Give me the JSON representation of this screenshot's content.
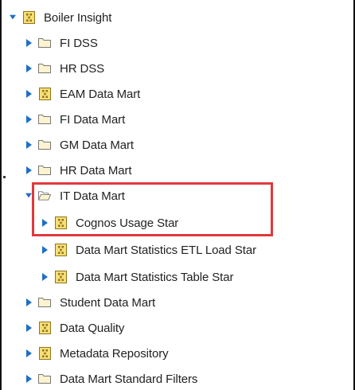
{
  "tree": {
    "items": [
      {
        "label": "Boiler Insight",
        "type": "package",
        "expanded": true,
        "level": 0
      },
      {
        "label": "FI DSS",
        "type": "folder",
        "expanded": false,
        "level": 1
      },
      {
        "label": "HR DSS",
        "type": "folder",
        "expanded": false,
        "level": 1
      },
      {
        "label": "EAM Data Mart",
        "type": "package",
        "expanded": false,
        "level": 1
      },
      {
        "label": "FI Data Mart",
        "type": "folder",
        "expanded": false,
        "level": 1
      },
      {
        "label": "GM Data Mart",
        "type": "folder",
        "expanded": false,
        "level": 1
      },
      {
        "label": "HR Data Mart",
        "type": "folder",
        "expanded": false,
        "level": 1
      },
      {
        "label": "IT Data Mart",
        "type": "folder-open",
        "expanded": true,
        "level": 1
      },
      {
        "label": "Cognos Usage Star",
        "type": "package",
        "expanded": false,
        "level": 2
      },
      {
        "label": "Data Mart Statistics ETL Load Star",
        "type": "package",
        "expanded": false,
        "level": 2
      },
      {
        "label": "Data Mart Statistics Table Star",
        "type": "package",
        "expanded": false,
        "level": 2
      },
      {
        "label": "Student Data Mart",
        "type": "folder",
        "expanded": false,
        "level": 1
      },
      {
        "label": "Data Quality",
        "type": "package",
        "expanded": false,
        "level": 1
      },
      {
        "label": "Metadata Repository",
        "type": "package",
        "expanded": false,
        "level": 1
      },
      {
        "label": "Data Mart Standard Filters",
        "type": "folder",
        "expanded": false,
        "level": 1
      }
    ]
  },
  "colors": {
    "twisty": "#1f6fc5",
    "folder_stroke": "#777777",
    "folder_fill": "#fdf4cf",
    "package_fill": "#f7df74",
    "package_stroke": "#8e7420",
    "highlight": "#e0393c",
    "text": "#222222"
  },
  "highlighted_item": "IT Data Mart"
}
